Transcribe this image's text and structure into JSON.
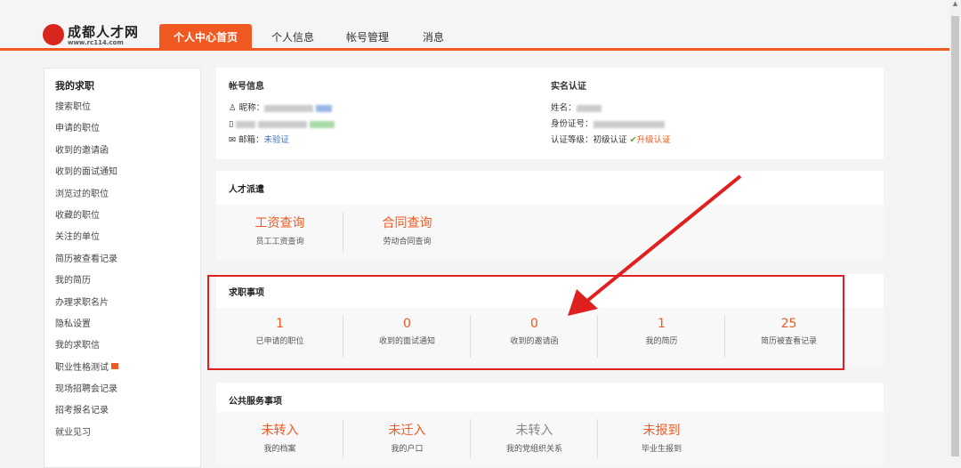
{
  "header": {
    "logo_name": "成都人才网",
    "logo_url": "www.rc114.com",
    "tabs": [
      "个人中心首页",
      "个人信息",
      "帐号管理",
      "消息"
    ]
  },
  "sidebar": {
    "title": "我的求职",
    "items": [
      "搜索职位",
      "申请的职位",
      "收到的邀请函",
      "收到的面试通知",
      "浏览过的职位",
      "收藏的职位",
      "关注的单位",
      "简历被查看记录",
      "我的简历",
      "办理求职名片",
      "隐私设置",
      "我的求职信",
      "职业性格测试",
      "现场招聘会记录",
      "招考报名记录",
      "就业见习"
    ]
  },
  "account": {
    "title": "帐号信息",
    "nickname_label": "昵称：",
    "phone_label": "",
    "email_label": "邮箱：",
    "email_value": "未验证"
  },
  "realname": {
    "title": "实名认证",
    "name_label": "姓名：",
    "id_label": "身份证号：",
    "level_label": "认证等级：",
    "level_value": "初级认证",
    "upgrade": "升级认证"
  },
  "dispatch": {
    "title": "人才派遣",
    "items": [
      {
        "value": "工资查询",
        "label": "员工工资查询"
      },
      {
        "value": "合同查询",
        "label": "劳动合同查询"
      }
    ]
  },
  "job": {
    "title": "求职事项",
    "items": [
      {
        "value": "1",
        "label": "已申请的职位"
      },
      {
        "value": "0",
        "label": "收到的面试通知"
      },
      {
        "value": "0",
        "label": "收到的邀请函"
      },
      {
        "value": "1",
        "label": "我的简历"
      },
      {
        "value": "25",
        "label": "简历被查看记录"
      }
    ]
  },
  "public": {
    "title": "公共服务事项",
    "items": [
      {
        "value": "未转入",
        "label": "我的档案"
      },
      {
        "value": "未迁入",
        "label": "我的户口"
      },
      {
        "value": "未转入",
        "label": "我的党组织关系"
      },
      {
        "value": "未报到",
        "label": "毕业生报到"
      }
    ]
  },
  "colors": {
    "accent": "#f05a22",
    "annotation": "#e0201e"
  }
}
